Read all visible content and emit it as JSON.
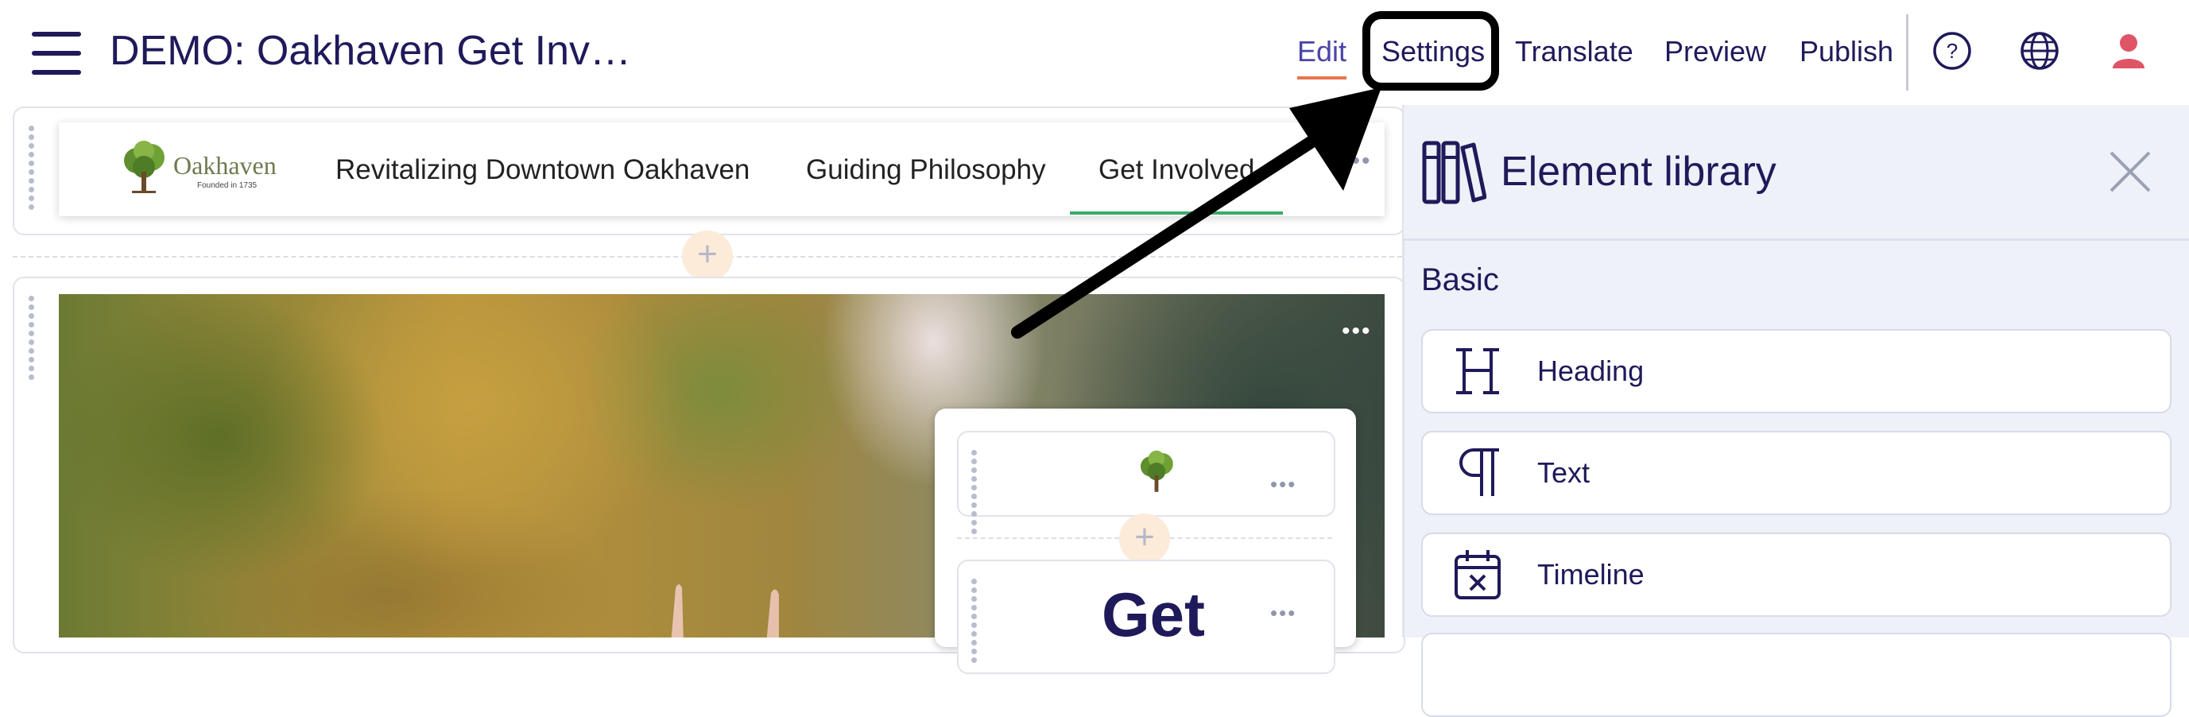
{
  "header": {
    "title": "DEMO: Oakhaven Get Inv…",
    "nav": {
      "edit": "Edit",
      "settings": "Settings",
      "translate": "Translate",
      "preview": "Preview",
      "publish": "Publish"
    }
  },
  "site_header": {
    "logo_name": "Oakhaven",
    "logo_subtitle": "Founded in 1735",
    "nav_items": [
      "Revitalizing Downtown Oakhaven",
      "Guiding Philosophy",
      "Get Involved"
    ],
    "more_label": "•••"
  },
  "hero": {
    "heading_partial": "Get",
    "more_label": "•••",
    "add_label": "+"
  },
  "sidebar": {
    "title": "Element library",
    "section": "Basic",
    "items": [
      {
        "label": "Heading",
        "icon": "heading-icon"
      },
      {
        "label": "Text",
        "icon": "paragraph-icon"
      },
      {
        "label": "Timeline",
        "icon": "calendar-x-icon"
      }
    ]
  },
  "colors": {
    "brand_text": "#1f1a5a",
    "edit_accent": "#e8764c",
    "active_nav_underline": "#3aaa6a",
    "sidebar_bg": "#eef1f8",
    "user_icon": "#e05566"
  }
}
